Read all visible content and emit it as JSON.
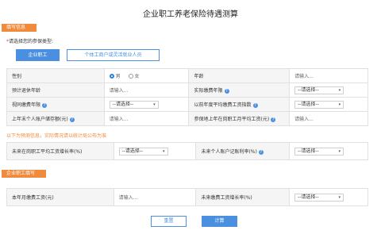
{
  "page": {
    "title": "企业职工养老保险待遇测算"
  },
  "section1": {
    "label": "填写信息"
  },
  "prompt": {
    "star": "*",
    "text": "请选择您的参保类型:"
  },
  "tabs": [
    {
      "label": "企业职工"
    },
    {
      "label": "个体工商户或灵活就业人员"
    }
  ],
  "form1": {
    "gender_label": "性别",
    "gender_male": "男",
    "gender_female": "女",
    "age_label": "年龄",
    "age_placeholder": "请输入...",
    "est_years_label": "预计退休年龄",
    "est_years_placeholder": "请输入...",
    "actual_years_label": "实际缴费年限",
    "actual_years_select": "--请选择--",
    "deemed_years_label": "视同缴费年限",
    "deemed_years_select": "--请选择--",
    "past_index_label": "以前年度平均缴费工资指数",
    "past_index_select": "--请选择--",
    "last_balance_label": "上年末个人账户储存额(元)",
    "last_balance_placeholder": "请输入...",
    "last_avg_wage_label": "参保地上年在岗职工月平均工资(元)",
    "last_avg_wage_placeholder": "请输入..."
  },
  "note": {
    "text": "以下为预测信息，实际情况请以统计局公布为准"
  },
  "form2": {
    "wage_growth_label": "未来在岗职工平均工资增长率(%)",
    "wage_growth_select": "--请选择--",
    "account_rate_label": "未来个人账户记账利率(%)",
    "account_rate_select": "--请选择--"
  },
  "section2": {
    "label": "企业职工填写"
  },
  "form3": {
    "month_pay_label": "本年月缴费工资(元)",
    "month_pay_placeholder": "请输入...",
    "pay_growth_label": "未来缴费工资增长率(%)",
    "pay_growth_select": "--请选择--"
  },
  "buttons": {
    "reset": "重置",
    "calc": "计算"
  },
  "icons": {
    "help": "?",
    "dropdown": "▾"
  },
  "colors": {
    "accent": "#4a8fe0",
    "section": "#f08a3c",
    "note": "#f08a3c"
  }
}
